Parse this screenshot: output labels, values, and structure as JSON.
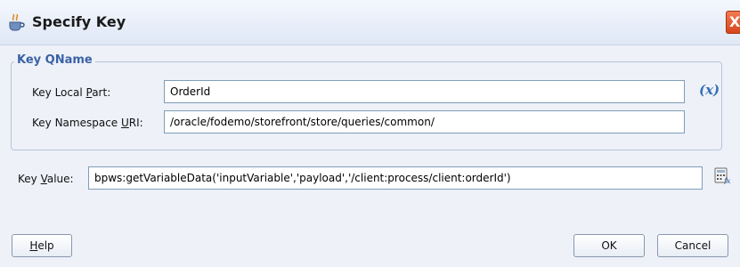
{
  "dialog": {
    "title": "Specify Key",
    "close_glyph": "X"
  },
  "key_qname": {
    "legend": "Key QName",
    "local_part": {
      "label_prefix": "Key Local ",
      "label_mnemonic": "P",
      "label_suffix": "art:",
      "value": "OrderId"
    },
    "namespace_uri": {
      "label_prefix": "Key Namespace ",
      "label_mnemonic": "U",
      "label_suffix": "RI:",
      "value": "/oracle/fodemo/storefront/store/queries/common/"
    },
    "variable_button": "(x)"
  },
  "key_value": {
    "label_prefix": "Key ",
    "label_mnemonic": "V",
    "label_suffix": "alue:",
    "value": "bpws:getVariableData('inputVariable','payload','/client:process/client:orderId')",
    "expression_builder_icon": "expression-builder-icon"
  },
  "buttons": {
    "help_mnemonic": "H",
    "help_rest": "elp",
    "ok": "OK",
    "cancel": "Cancel"
  },
  "colors": {
    "legend": "#3b62a6",
    "close": "#d9441c",
    "field_border": "#7f9db9"
  }
}
